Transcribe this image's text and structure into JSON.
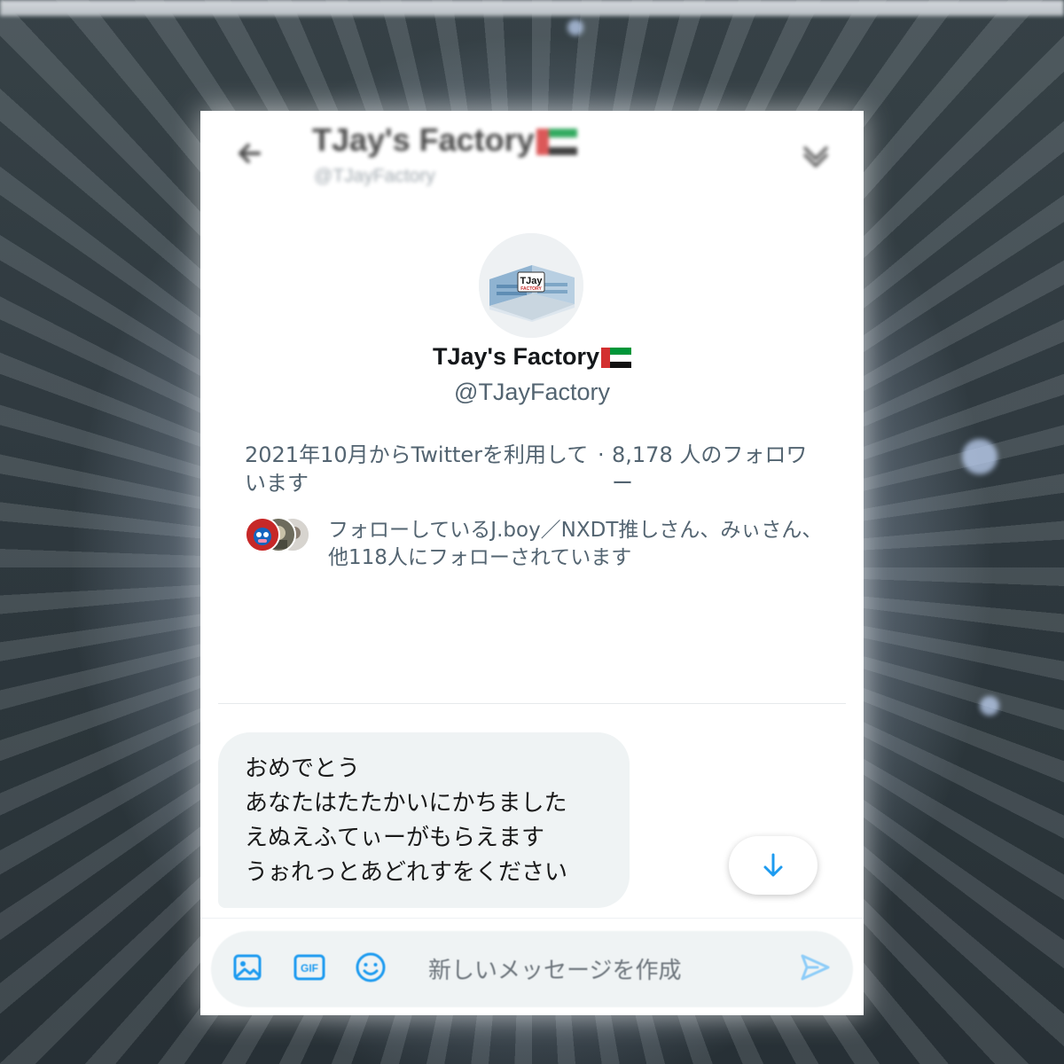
{
  "header": {
    "title": "TJay's Factory",
    "handle": "@TJayFactory"
  },
  "profile": {
    "avatar_label": "TJay",
    "avatar_sub": "FACTORY",
    "name": "TJay's Factory",
    "handle": "@TJayFactory",
    "joined": "2021年10月からTwitterを利用しています",
    "followers_sep": "·",
    "followers": "8,178 人のフォロワー",
    "followed_by": "フォローしているJ.boy／NXDT推しさん、みぃさん、他118人にフォローされています"
  },
  "message": {
    "lines": [
      "おめでとう",
      "あなたはたたかいにかちました",
      "えぬえふてぃーがもらえます",
      "うぉれっとあどれすをください"
    ]
  },
  "composer": {
    "placeholder": "新しいメッセージを作成",
    "gif_label": "GIF"
  },
  "icons": {
    "back": "back-arrow-icon",
    "info": "chevron-down-icon",
    "image": "image-icon",
    "gif": "gif-icon",
    "emoji": "emoji-icon",
    "send": "send-icon",
    "scroll": "arrow-down-icon"
  },
  "colors": {
    "accent": "#1d9bf0",
    "bubble": "#eff3f4",
    "secondary_text": "#536471"
  }
}
